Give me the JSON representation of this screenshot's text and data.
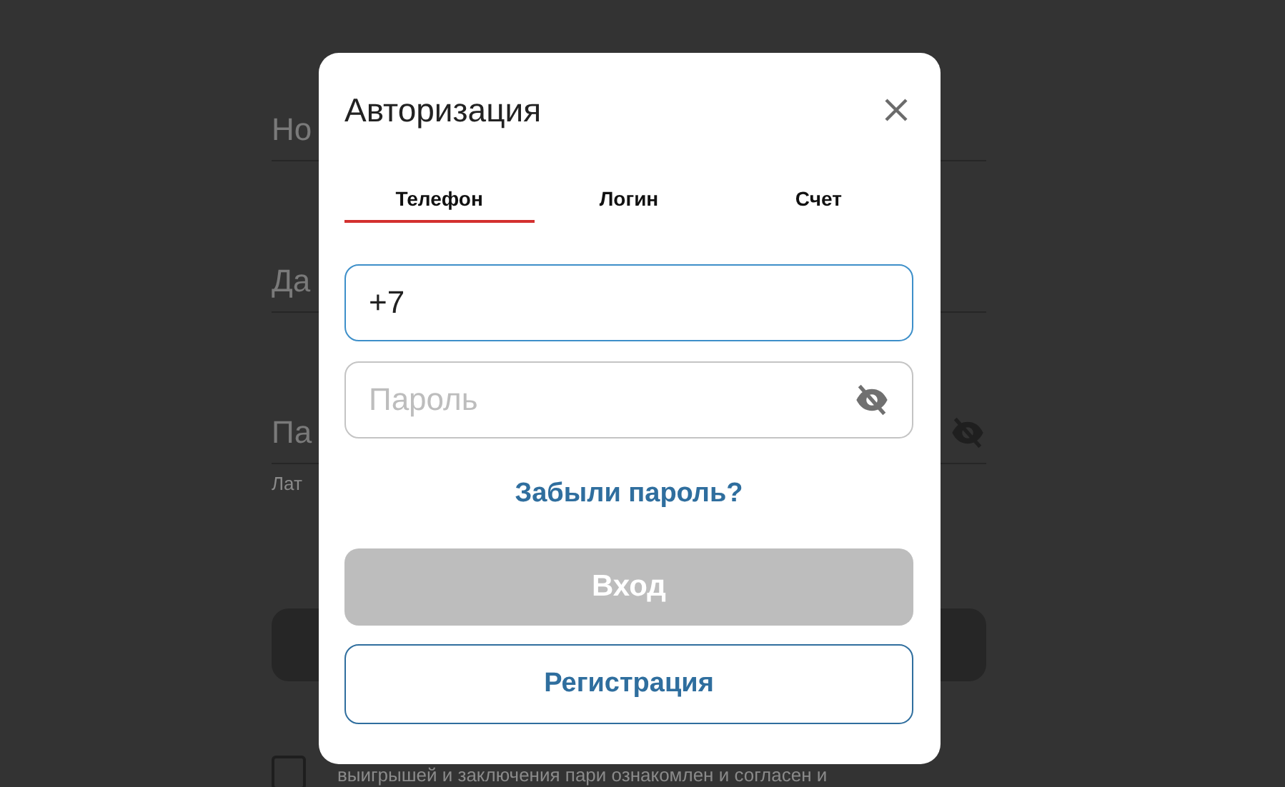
{
  "background_form": {
    "fields": [
      {
        "label": "Но",
        "kind": "text"
      },
      {
        "label": "Да",
        "kind": "text"
      },
      {
        "label": "Па",
        "kind": "password",
        "hint": "Лат"
      }
    ],
    "terms": {
      "checked": false,
      "lines": [
        "выигрышей и заключения пари ознакомлен и согласен и"
      ]
    }
  },
  "dialog": {
    "title": "Авторизация",
    "tabs": [
      {
        "label": "Телефон",
        "selected": true
      },
      {
        "label": "Логин",
        "selected": false
      },
      {
        "label": "Счет",
        "selected": false
      }
    ],
    "phone_field": {
      "value": "+7"
    },
    "password_field": {
      "placeholder": "Пароль"
    },
    "forgot_link": "Забыли пароль?",
    "login_button": {
      "label": "Вход",
      "disabled": true
    },
    "register_button": {
      "label": "Регистрация"
    }
  }
}
